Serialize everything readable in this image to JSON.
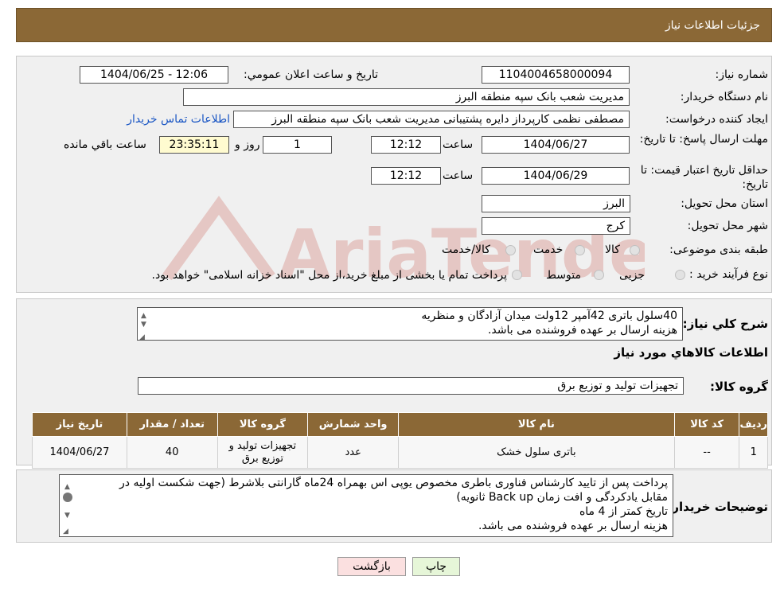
{
  "header": {
    "title": "جزئیات اطلاعات نیاز"
  },
  "labels": {
    "need_number": "شماره نیاز:",
    "announce_datetime": "تاریخ و ساعت اعلان عمومي:",
    "buyer_org": "نام دستگاه خريدار:",
    "requester": "ايجاد كننده درخواست:",
    "send_deadline": "مهلت ارسال پاسخ: تا تاریخ:",
    "price_valid": "حداقل تاريخ اعتبار قيمت: تا تاریخ:",
    "time": "ساعت",
    "day_and": "روز و",
    "remaining": "ساعت باقي مانده",
    "province": "استان محل تحویل:",
    "city": "شهر محل تحویل:",
    "category": "طبقه بندی موضوعی:",
    "purchase_type": "نوع فرآیند خرید :",
    "overall_desc": "شرح كلي نياز:",
    "goods_info": "اطلاعات كالاهاي مورد نياز",
    "goods_group": "گروه كالا:",
    "buyer_notes": "توضیحات خریدار:"
  },
  "values": {
    "need_number": "1104004658000094",
    "announce_datetime": "1404/06/25 - 12:06",
    "buyer_org": "مدیریت شعب بانک سپه منطقه البرز",
    "requester": "مصطفی نظمی کارپرداز دایره پشتیبانی مدیریت شعب بانک سپه منطقه البرز",
    "contact_link": "اطلاعات تماس خریدار",
    "send_date": "1404/06/27",
    "send_time": "12:12",
    "days": "1",
    "remaining_time": "23:35:11",
    "price_date": "1404/06/29",
    "price_time": "12:12",
    "province": "البرز",
    "city": "کرج"
  },
  "category_options": [
    "کالا",
    "خدمت",
    "کالا/خدمت"
  ],
  "purchase_options": [
    "جزیی",
    "متوسط"
  ],
  "purchase_note": "پرداخت تمام یا بخشی از مبلغ خرید،از محل \"اسناد خزانه اسلامی\" خواهد بود.",
  "overall_desc": {
    "line1": "40سلول باتری 42آمپر 12ولت میدان آزادگان و منظریه",
    "line2": "هزینه ارسال بر عهده فروشنده می باشد."
  },
  "goods_group_value": "تجهیزات تولید و توزیع برق",
  "table": {
    "headers": [
      "ردیف",
      "کد کالا",
      "نام کالا",
      "واحد شمارش",
      "گروه کالا",
      "تعداد / مقدار",
      "تاریخ نیاز"
    ],
    "rows": [
      [
        "1",
        "--",
        "باتری سلول خشک",
        "عدد",
        "تجهیزات تولید و توزیع برق",
        "40",
        "1404/06/27"
      ]
    ]
  },
  "buyer_notes": {
    "line1": "پرداخت پس از تایید کارشناس فناوری باطری مخصوص یوپی اس بهمراه 24ماه گارانتی بلاشرط (جهت شکست اولیه در",
    "line2": "مقابل یادکردگی و افت زمان Back up ثانویه)",
    "line3": "تاریخ کمتر از 4 ماه",
    "line4": "هزینه ارسال بر عهده فروشنده می باشد."
  },
  "buttons": {
    "print": "چاپ",
    "back": "بازگشت"
  },
  "colors": {
    "header_bg": "#8b6836",
    "link": "#1a56c4",
    "print_btn": "#e6f6d8",
    "back_btn": "#fbe0e0",
    "remain_bg": "#fffbd0"
  },
  "watermark_text": "AriaTender.neT"
}
